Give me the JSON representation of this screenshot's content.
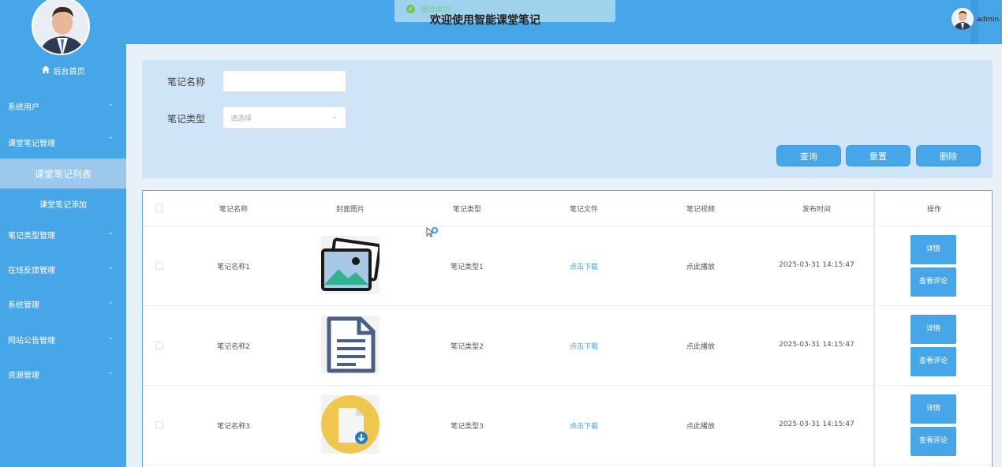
{
  "header": {
    "title": "欢迎使用智能课堂笔记",
    "user_name": "admin",
    "toast": "修改成功!"
  },
  "sidebar": {
    "home": "后台首页",
    "menu": [
      {
        "label": "系统用户"
      },
      {
        "label": "课堂笔记管理"
      },
      {
        "label": "课堂笔记列表"
      },
      {
        "label": "课堂笔记添加"
      },
      {
        "label": "笔记类型管理"
      },
      {
        "label": "在线反馈管理"
      },
      {
        "label": "系统管理"
      },
      {
        "label": "网站公告管理"
      },
      {
        "label": "资源管理"
      }
    ]
  },
  "search": {
    "name_label": "笔记名称",
    "name_value": "",
    "type_label": "笔记类型",
    "type_placeholder": "请选择",
    "query_btn": "查询",
    "reset_btn": "重置",
    "delete_btn": "删除"
  },
  "table": {
    "headers": [
      "笔记名称",
      "封面图片",
      "笔记类型",
      "笔记文件",
      "笔记视频",
      "发布时间",
      "操作"
    ],
    "rows": [
      {
        "name": "笔记名称1",
        "type": "笔记类型1",
        "file": "点击下载",
        "video": "点此播放",
        "time": "2025-03-31 14:15:47",
        "cover": "image-icon"
      },
      {
        "name": "笔记名称2",
        "type": "笔记类型2",
        "file": "点击下载",
        "video": "点此播放",
        "time": "2025-03-31 14:15:47",
        "cover": "document-icon"
      },
      {
        "name": "笔记名称3",
        "type": "笔记类型3",
        "file": "点击下载",
        "video": "点此播放",
        "time": "2025-03-31 14:15:47",
        "cover": "download-file-icon"
      }
    ],
    "detail_btn": "详情",
    "comment_btn": "查看评论"
  }
}
